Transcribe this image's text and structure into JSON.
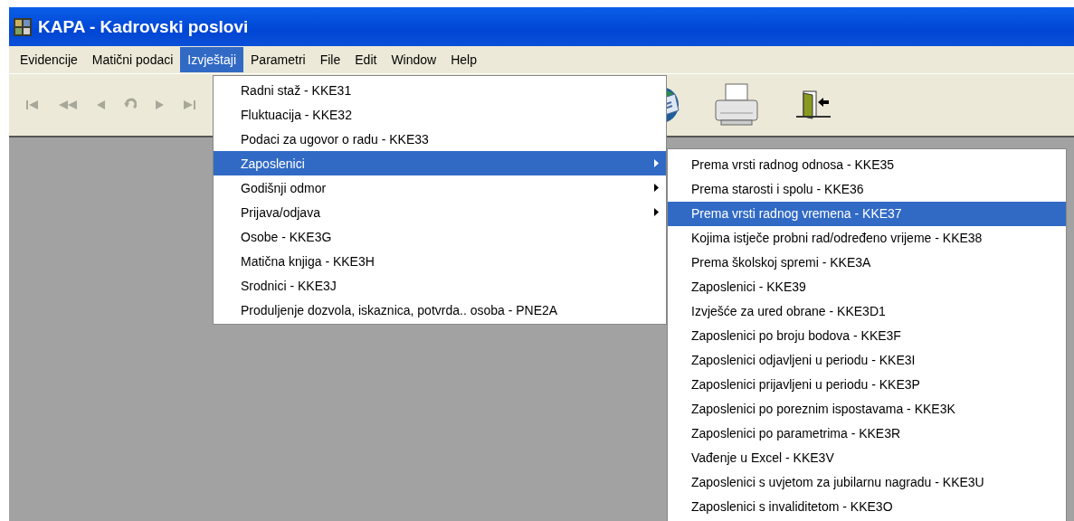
{
  "window": {
    "title": "KAPA - Kadrovski poslovi"
  },
  "menubar": [
    {
      "label": "Evidencije",
      "selected": false
    },
    {
      "label": "Matični podaci",
      "selected": false
    },
    {
      "label": "Izvještaji",
      "selected": true
    },
    {
      "label": "Parametri",
      "selected": false
    },
    {
      "label": "File",
      "selected": false
    },
    {
      "label": "Edit",
      "selected": false
    },
    {
      "label": "Window",
      "selected": false
    },
    {
      "label": "Help",
      "selected": false
    }
  ],
  "dropdown": {
    "items": [
      {
        "label": "Radni staž - KKE31",
        "has_submenu": false,
        "selected": false
      },
      {
        "label": "Fluktuacija - KKE32",
        "has_submenu": false,
        "selected": false
      },
      {
        "label": "Podaci za ugovor o radu - KKE33",
        "has_submenu": false,
        "selected": false
      },
      {
        "label": "Zaposlenici",
        "has_submenu": true,
        "selected": true
      },
      {
        "label": "Godišnji odmor",
        "has_submenu": true,
        "selected": false
      },
      {
        "label": "Prijava/odjava",
        "has_submenu": true,
        "selected": false
      },
      {
        "label": "Osobe - KKE3G",
        "has_submenu": false,
        "selected": false
      },
      {
        "label": "Matična knjiga - KKE3H",
        "has_submenu": false,
        "selected": false
      },
      {
        "label": "Srodnici - KKE3J",
        "has_submenu": false,
        "selected": false
      },
      {
        "label": "Produljenje dozvola, iskaznica, potvrda.. osoba - PNE2A",
        "has_submenu": false,
        "selected": false
      }
    ]
  },
  "submenu": {
    "items": [
      {
        "label": "Prema vrsti radnog odnosa - KKE35",
        "selected": false
      },
      {
        "label": "Prema starosti i spolu - KKE36",
        "selected": false
      },
      {
        "label": "Prema vrsti radnog vremena - KKE37",
        "selected": true
      },
      {
        "label": "Kojima istječe probni rad/određeno vrijeme - KKE38",
        "selected": false
      },
      {
        "label": "Prema školskoj spremi - KKE3A",
        "selected": false
      },
      {
        "label": "Zaposlenici - KKE39",
        "selected": false
      },
      {
        "label": "Izvješće za ured obrane - KKE3D1",
        "selected": false
      },
      {
        "label": "Zaposlenici po broju bodova - KKE3F",
        "selected": false
      },
      {
        "label": "Zaposlenici odjavljeni u periodu - KKE3I",
        "selected": false
      },
      {
        "label": "Zaposlenici prijavljeni u periodu - KKE3P",
        "selected": false
      },
      {
        "label": "Zaposlenici po poreznim ispostavama - KKE3K",
        "selected": false
      },
      {
        "label": "Zaposlenici po parametrima - KKE3R",
        "selected": false
      },
      {
        "label": "Vađenje u Excel - KKE3V",
        "selected": false
      },
      {
        "label": "Zaposlenici s uvjetom za jubilarnu nagradu - KKE3U",
        "selected": false
      },
      {
        "label": "Zaposlenici s invaliditetom - KKE3O",
        "selected": false
      }
    ]
  }
}
